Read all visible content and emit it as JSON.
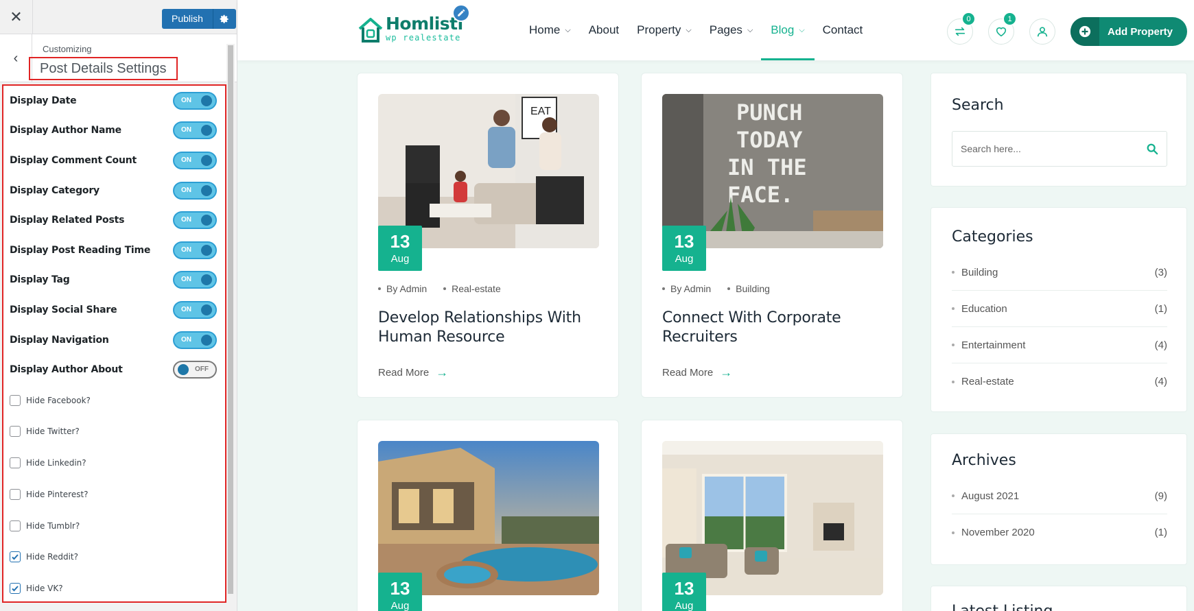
{
  "customizer": {
    "close_icon": "close-icon",
    "publish_label": "Publish",
    "kicker": "Customizing",
    "section_title": "Post Details Settings",
    "toggles": [
      {
        "label": "Display Date",
        "state": "ON"
      },
      {
        "label": "Display Author Name",
        "state": "ON"
      },
      {
        "label": "Display Comment Count",
        "state": "ON"
      },
      {
        "label": "Display Category",
        "state": "ON"
      },
      {
        "label": "Display Related Posts",
        "state": "ON"
      },
      {
        "label": "Display Post Reading Time",
        "state": "ON"
      },
      {
        "label": "Display Tag",
        "state": "ON"
      },
      {
        "label": "Display Social Share",
        "state": "ON"
      },
      {
        "label": "Display Navigation",
        "state": "ON"
      },
      {
        "label": "Display Author About",
        "state": "OFF"
      }
    ],
    "checkboxes": [
      {
        "label": "Hide Facebook?",
        "checked": false
      },
      {
        "label": "Hide Twitter?",
        "checked": false
      },
      {
        "label": "Hide Linkedin?",
        "checked": false
      },
      {
        "label": "Hide Pinterest?",
        "checked": false
      },
      {
        "label": "Hide Tumblr?",
        "checked": false
      },
      {
        "label": "Hide Reddit?",
        "checked": true
      },
      {
        "label": "Hide VK?",
        "checked": true
      }
    ]
  },
  "site": {
    "logo_name": "Homlisti",
    "logo_tagline": "wp realestate",
    "nav": [
      {
        "label": "Home",
        "dropdown": true
      },
      {
        "label": "About",
        "dropdown": false
      },
      {
        "label": "Property",
        "dropdown": true
      },
      {
        "label": "Pages",
        "dropdown": true
      },
      {
        "label": "Blog",
        "dropdown": true,
        "active": true
      },
      {
        "label": "Contact",
        "dropdown": false
      }
    ],
    "compare_count": "0",
    "favorites_count": "1",
    "add_property_label": "Add Property",
    "accent_color": "#15b28f"
  },
  "posts": [
    {
      "day": "13",
      "month": "Aug",
      "author": "By Admin",
      "category": "Real-estate",
      "title": "Develop Relationships With Human Resource",
      "read_more": "Read More"
    },
    {
      "day": "13",
      "month": "Aug",
      "author": "By Admin",
      "category": "Building",
      "title": "Connect With Corporate Recruiters",
      "read_more": "Read More"
    },
    {
      "day": "13",
      "month": "Aug"
    },
    {
      "day": "13",
      "month": "Aug"
    }
  ],
  "sidebar": {
    "search_title": "Search",
    "search_placeholder": "Search here...",
    "categories_title": "Categories",
    "categories": [
      {
        "name": "Building",
        "count": "(3)"
      },
      {
        "name": "Education",
        "count": "(1)"
      },
      {
        "name": "Entertainment",
        "count": "(4)"
      },
      {
        "name": "Real-estate",
        "count": "(4)"
      }
    ],
    "archives_title": "Archives",
    "archives": [
      {
        "name": "August 2021",
        "count": "(9)"
      },
      {
        "name": "November 2020",
        "count": "(1)"
      }
    ],
    "latest_title": "Latest Listing"
  }
}
